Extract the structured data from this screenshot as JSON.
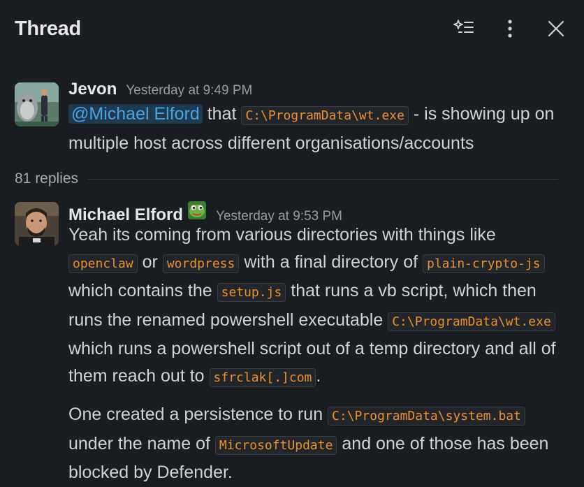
{
  "header": {
    "title": "Thread"
  },
  "icons": {
    "ai": "sparkle-list-icon",
    "more": "more-vertical-icon",
    "close": "close-icon"
  },
  "messages": [
    {
      "author": "Jevon",
      "time": "Yesterday at 9:49 PM",
      "mention": "@Michael Elford",
      "text1": " that ",
      "code1": "C:\\ProgramData\\wt.exe",
      "text2": "  - is showing up on multiple host across different organisations/accounts"
    },
    {
      "author": "Michael Elford",
      "time": "Yesterday at 9:53 PM",
      "p1": {
        "t1": "Yeah its coming from various directories with things like ",
        "c1": "openclaw",
        "t2": " or ",
        "c2": "wordpress",
        "t3": " with a final directory of ",
        "c3": "plain-crypto-js",
        "t4": " which contains the ",
        "c4": "setup.js",
        "t5": " that runs a vb script, which then runs the renamed powershell executable ",
        "c5": "C:\\ProgramData\\wt.exe",
        "t6": " which runs a powershell script out of a temp directory and all of them reach out to ",
        "c6": "sfrclak[.]com",
        "t7": "."
      },
      "p2": {
        "t1": "One created a persistence to run ",
        "c1": "C:\\ProgramData\\system.bat",
        "t2": " under the name of ",
        "c2": "MicrosoftUpdate",
        "t3": " and one of those has been blocked by Defender."
      }
    }
  ],
  "replies": {
    "label": "81 replies"
  },
  "colors": {
    "background": "#1a1d21",
    "mention_bg": "#1d3a4f",
    "mention_text": "#4aa3df",
    "code_text": "#e8912d"
  }
}
